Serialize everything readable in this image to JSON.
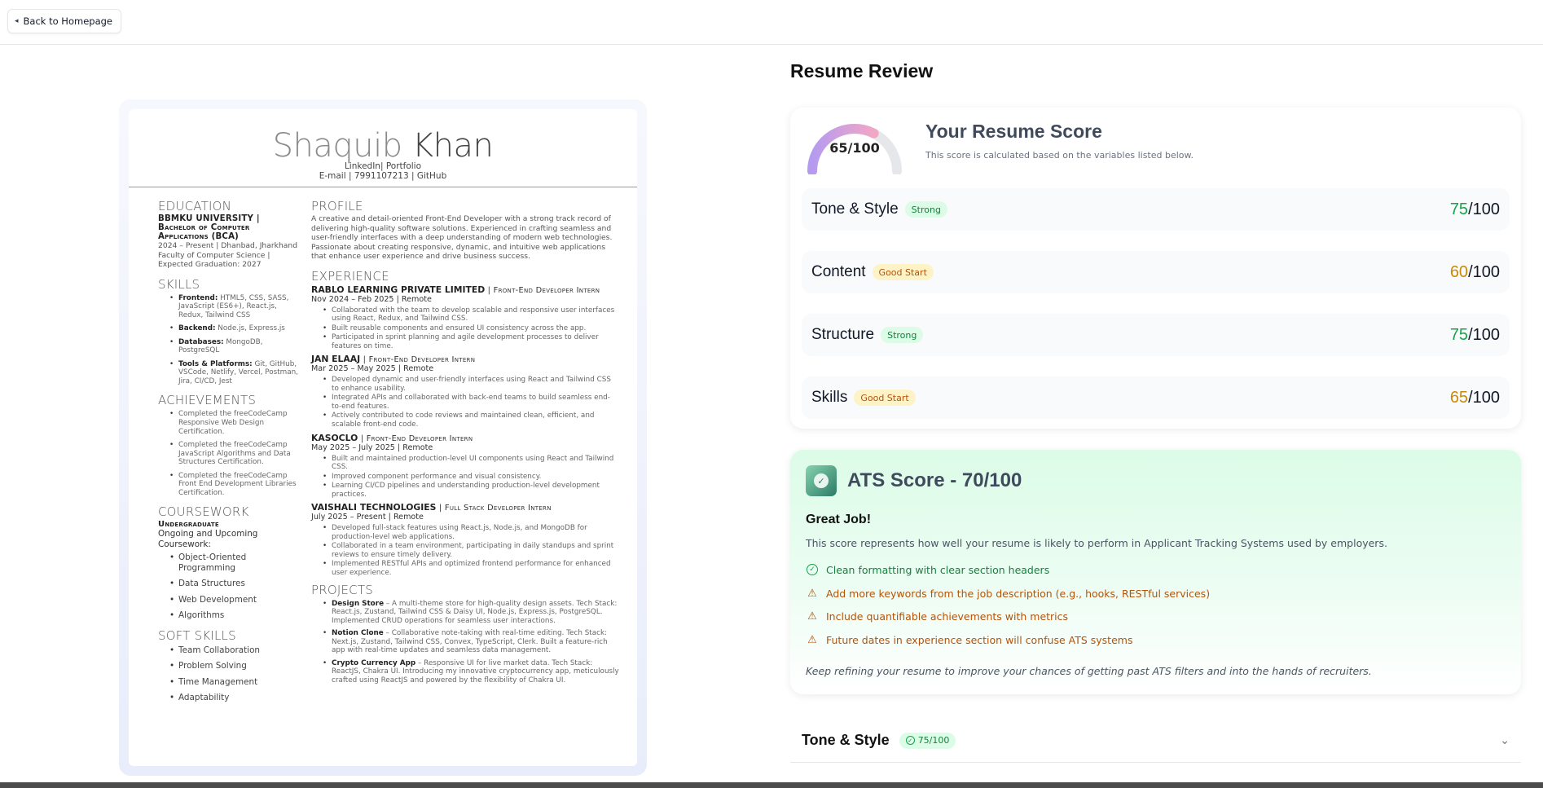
{
  "header": {
    "back_label": "Back to Homepage"
  },
  "resume": {
    "name_first": "Shaquib",
    "name_last": "Khan",
    "contact_line1": "LinkedIn| Portfolio",
    "contact_line2": "E-mail | 7991107213 | GitHub",
    "education": {
      "heading": "EDUCATION",
      "school": "BBMKU UNIVERSITY",
      "degree_l1": "Bachelor of Computer",
      "degree_l2": "Applications (BCA)",
      "dates": "2024 – Present | Dhanbad, Jharkhand",
      "detail": "Faculty of Computer Science | Expected Graduation: 2027"
    },
    "skills": {
      "heading": "SKILLS",
      "items": [
        {
          "label": "Frontend:",
          "text": " HTML5, CSS, SASS, JavaScript (ES6+), React.js, Redux, Tailwind CSS"
        },
        {
          "label": "Backend:",
          "text": " Node.js, Express.js"
        },
        {
          "label": "Databases:",
          "text": " MongoDB, PostgreSQL"
        },
        {
          "label": "Tools & Platforms:",
          "text": " Git, GitHub, VSCode, Netlify, Vercel, Postman, Jira, CI/CD, Jest"
        }
      ]
    },
    "achievements": {
      "heading": "ACHIEVEMENTS",
      "items": [
        "Completed the freeCodeCamp Responsive Web Design Certification.",
        "Completed the freeCodeCamp JavaScript Algorithms and Data Structures Certification.",
        "Completed the freeCodeCamp Front End Development Libraries Certification."
      ]
    },
    "coursework": {
      "heading": "COURSEWORK",
      "level": "Undergraduate",
      "subtitle": "Ongoing and Upcoming Coursework:",
      "items": [
        "Object-Oriented Programming",
        "Data Structures",
        "Web Development",
        "Algorithms"
      ]
    },
    "soft_skills": {
      "heading": "SOFT SKILLS",
      "items": [
        "Team Collaboration",
        "Problem Solving",
        "Time Management",
        "Adaptability"
      ]
    },
    "profile": {
      "heading": "PROFILE",
      "text": "A creative and detail-oriented Front-End Developer with a strong track record of delivering high-quality software solutions. Experienced in crafting seamless and user-friendly interfaces with a deep understanding of modern web technologies. Passionate about creating responsive, dynamic, and intuitive web applications that enhance user experience and drive business success."
    },
    "experience": {
      "heading": "EXPERIENCE",
      "jobs": [
        {
          "company": "RABLO LEARNING PRIVATE LIMITED",
          "role": " | Front-End Developer Intern",
          "dates": "Nov 2024 – Feb 2025 | Remote",
          "bullets": [
            "Collaborated with the team to develop scalable and responsive user interfaces using React, Redux, and Tailwind CSS.",
            "Built reusable components and ensured UI consistency across the app.",
            "Participated in sprint planning and agile development processes to deliver features on time."
          ]
        },
        {
          "company": "JAN ELAAJ",
          "role": " | Front-End Developer Intern",
          "dates": "Mar 2025 – May 2025 | Remote",
          "bullets": [
            "Developed dynamic and user-friendly interfaces using React and Tailwind CSS to enhance usability.",
            "Integrated APIs and collaborated with back-end teams to build seamless end-to-end features.",
            "Actively contributed to code reviews and maintained clean, efficient, and scalable front-end code."
          ]
        },
        {
          "company": "KASOCLO",
          "role": " | Front-End Developer Intern",
          "dates": "May 2025 – July 2025 | Remote",
          "bullets": [
            "Built and maintained production-level UI components using React and Tailwind CSS.",
            "Improved component performance and visual consistency.",
            "Learning CI/CD pipelines and understanding production-level development practices."
          ]
        },
        {
          "company": "VAISHALI TECHNOLOGIES",
          "role": " | Full Stack Developer Intern",
          "dates": "July 2025 – Present | Remote",
          "bullets": [
            "Developed full-stack features using React.js, Node.js, and MongoDB for production-level web applications.",
            "Collaborated in a team environment, participating in daily standups and sprint reviews to ensure timely delivery.",
            "Implemented RESTful APIs and optimized frontend performance for enhanced user experience."
          ]
        }
      ]
    },
    "projects": {
      "heading": "PROJECTS",
      "items": [
        {
          "label": "Design Store",
          "text": " – A multi-theme store for high-quality design assets. Tech Stack: React.js, Zustand, Tailwind CSS & Daisy UI, Node.js, Express.js, PostgreSQL. Implemented CRUD operations for seamless user interactions."
        },
        {
          "label": "Notion Clone",
          "text": " – Collaborative note-taking with real-time editing. Tech Stack: Next.js, Zustand, Tailwind CSS, Convex, TypeScript, Clerk. Built a feature-rich app with real-time updates and seamless data management."
        },
        {
          "label": "Crypto Currency App",
          "text": " – Responsive UI for live market data. Tech Stack: ReactJS, Chakra UI. Introducing my innovative cryptocurrency app, meticulously crafted using ReactJS and powered by the flexibility of Chakra UI."
        }
      ]
    }
  },
  "review": {
    "title": "Resume Review",
    "overall": {
      "label": "65/100",
      "value": 65,
      "max": 100
    },
    "score_heading": "Your Resume Score",
    "score_desc": "This score is calculated based on the variables listed below.",
    "categories": [
      {
        "name": "Tone & Style",
        "badge": "Strong",
        "score": "75",
        "max": "/100"
      },
      {
        "name": "Content",
        "badge": "Good Start",
        "score": "60",
        "max": "/100"
      },
      {
        "name": "Structure",
        "badge": "Strong",
        "score": "75",
        "max": "/100"
      },
      {
        "name": "Skills",
        "badge": "Good Start",
        "score": "65",
        "max": "/100"
      }
    ]
  },
  "ats": {
    "title": "ATS Score - 70/100",
    "great": "Great Job!",
    "desc": "This score represents how well your resume is likely to perform in Applicant Tracking Systems used by employers.",
    "items": [
      {
        "kind": "ok",
        "text": "Clean formatting with clear section headers"
      },
      {
        "kind": "warn",
        "text": "Add more keywords from the job description (e.g., hooks, RESTful services)"
      },
      {
        "kind": "warn",
        "text": "Include quantifiable achievements with metrics"
      },
      {
        "kind": "warn",
        "text": "Future dates in experience section will confuse ATS systems"
      }
    ],
    "footer": "Keep refining your resume to improve your chances of getting past ATS filters and into the hands of recruiters."
  },
  "accordion": {
    "title": "Tone & Style",
    "badge": "75/100"
  }
}
